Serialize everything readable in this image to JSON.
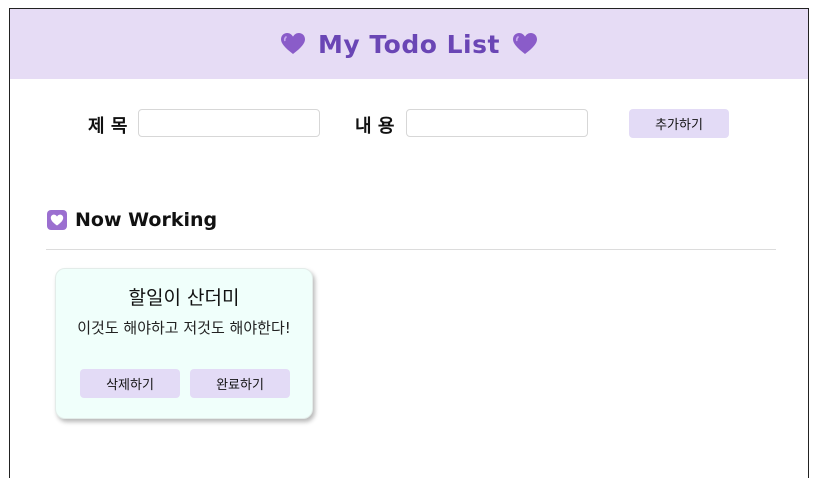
{
  "header": {
    "title": "My Todo List",
    "emoji_icon": "purple-heart-icon"
  },
  "form": {
    "title_label": "제 목",
    "title_value": "",
    "content_label": "내 용",
    "content_value": "",
    "add_button_label": "추가하기"
  },
  "working_section": {
    "title": "Now Working",
    "icon": "heart-box-icon"
  },
  "todos": [
    {
      "title": "할일이 산더미",
      "body": "이것도 해야하고 저것도 해야한다!",
      "delete_label": "삭제하기",
      "complete_label": "완료하기"
    }
  ],
  "colors": {
    "header_bg": "#e6dcf5",
    "title_color": "#6a46b5",
    "button_bg": "#e3dbf6",
    "card_bg": "#f0fffb"
  }
}
